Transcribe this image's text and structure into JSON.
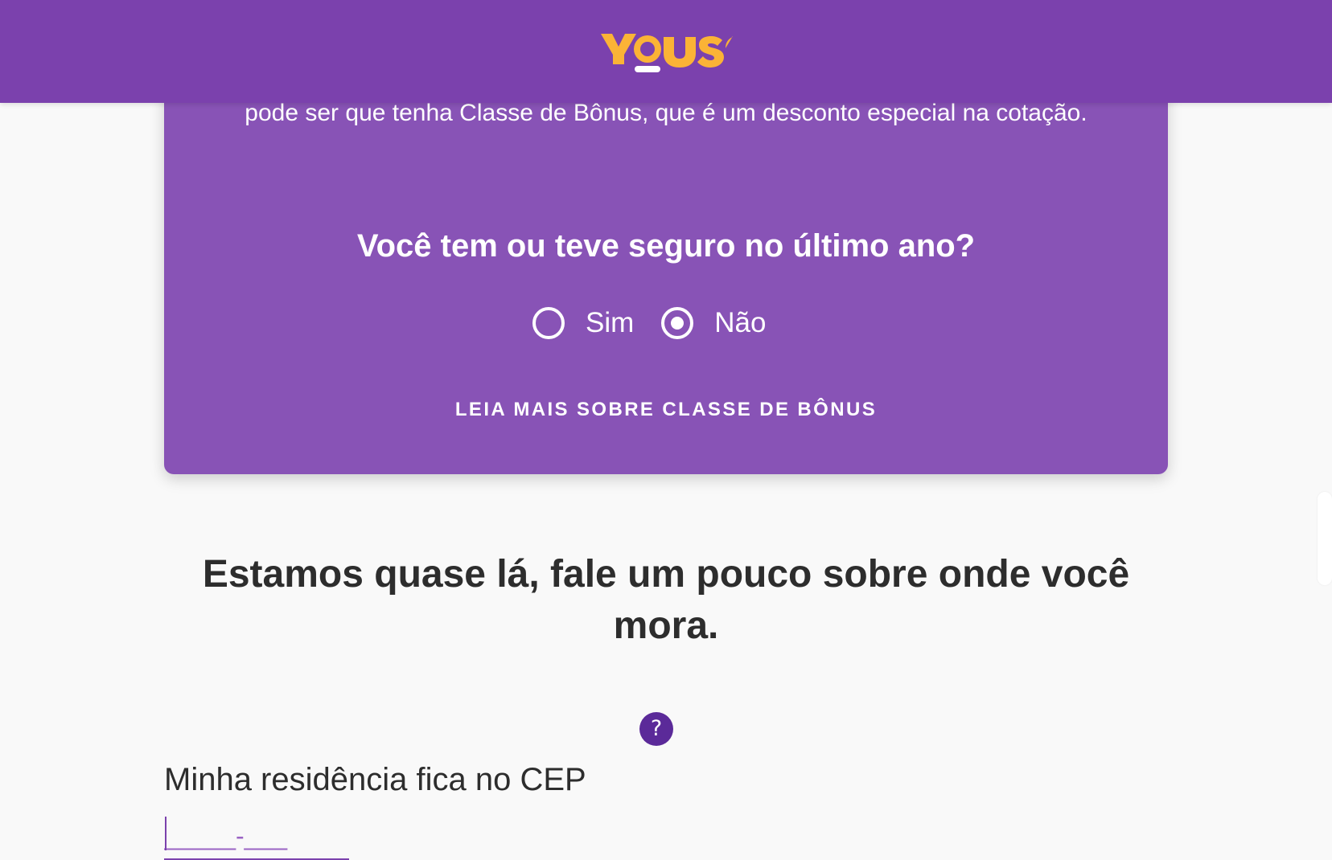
{
  "brand": {
    "logo_text": "YOUSE",
    "colors": {
      "header_bg": "#7b41ad",
      "card_bg": "#8853b6",
      "logo": "#fbb336",
      "help_icon_bg": "#5b2a99",
      "page_bg": "#f9f9f9",
      "text_dark": "#2d2d2d"
    }
  },
  "card": {
    "text": "pode ser que tenha Classe de Bônus, que é um desconto especial na cotação.",
    "question": "Você tem ou teve seguro no último ano?",
    "options": [
      {
        "label": "Sim",
        "selected": false
      },
      {
        "label": "Não",
        "selected": true
      }
    ],
    "read_more": "LEIA MAIS SOBRE CLASSE DE BÔNUS"
  },
  "address": {
    "title": "Estamos quase lá, fale um pouco sobre onde você mora.",
    "help_icon": "?",
    "cep_label": "Minha residência fica no CEP",
    "cep_placeholder": "_____-___"
  }
}
